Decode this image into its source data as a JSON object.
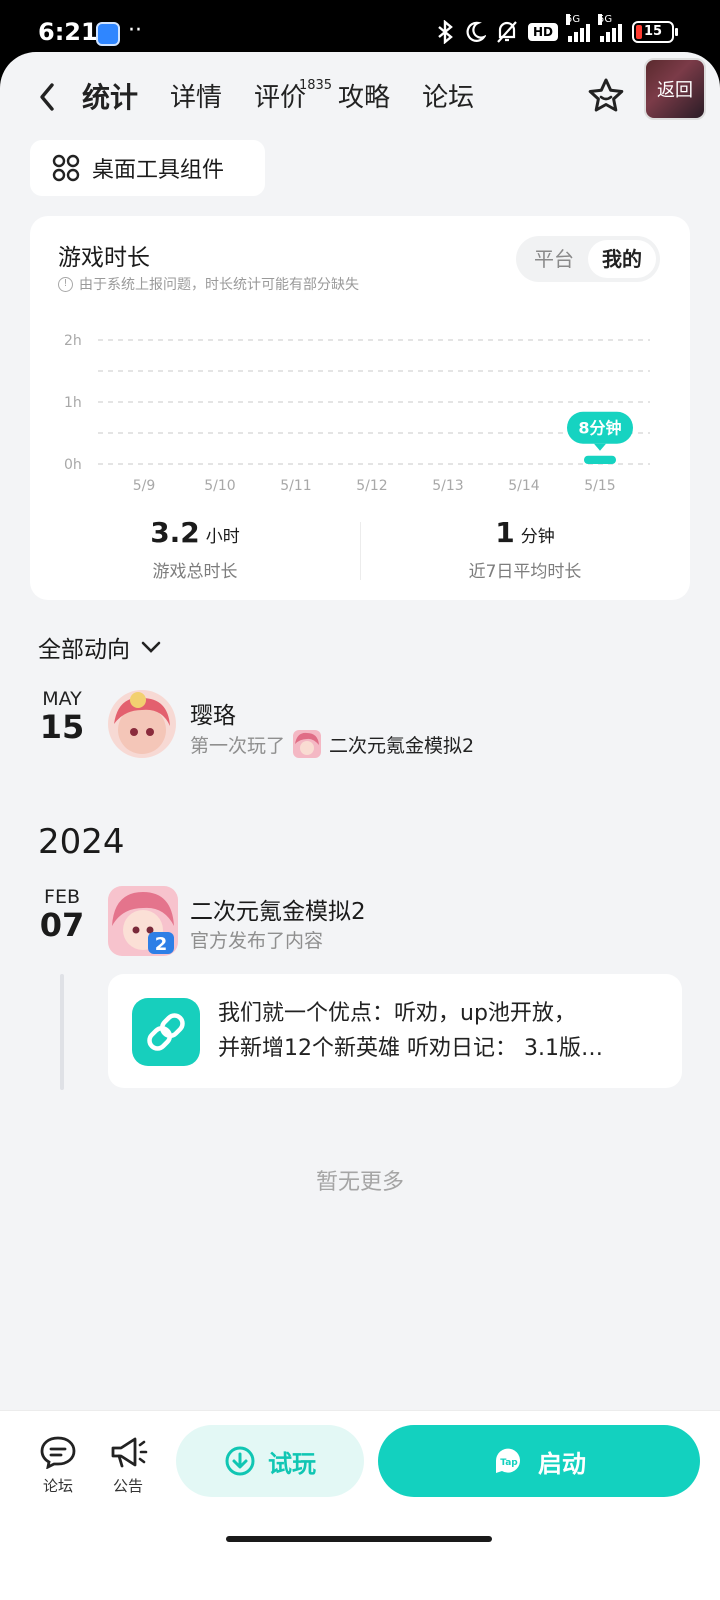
{
  "status_bar": {
    "time": "6:21",
    "dots": "··",
    "hd_badge": "HD",
    "network_1": "5G",
    "network_2": "5G",
    "battery_level": "15"
  },
  "nav": {
    "tabs": [
      {
        "label": "统计",
        "active": true
      },
      {
        "label": "详情",
        "active": false
      },
      {
        "label": "评价",
        "badge": "1835",
        "active": false
      },
      {
        "label": "攻略",
        "active": false
      },
      {
        "label": "论坛",
        "active": false
      }
    ],
    "return_label": "返回"
  },
  "widget_button": {
    "label": "桌面工具组件"
  },
  "stats_card": {
    "title": "游戏时长",
    "note": "由于系统上报问题，时长统计可能有部分缺失",
    "segments": [
      "平台",
      "我的"
    ],
    "selected_segment": "我的",
    "total": {
      "value": "3.2",
      "unit": "小时",
      "label": "游戏总时长"
    },
    "average": {
      "value": "1",
      "unit": "分钟",
      "label": "近7日平均时长"
    }
  },
  "chart_data": {
    "type": "bar",
    "categories": [
      "5/9",
      "5/10",
      "5/11",
      "5/12",
      "5/13",
      "5/14",
      "5/15"
    ],
    "values_minutes": [
      0,
      0,
      0,
      0,
      0,
      0,
      8
    ],
    "y_ticks": [
      "2h",
      "1h",
      "0h"
    ],
    "ylim_minutes": [
      0,
      120
    ],
    "grid": true,
    "highlight_label": "8分钟",
    "accent_color": "#16d3c1"
  },
  "feed": {
    "filter_label": "全部动向",
    "items": [
      {
        "month": "MAY",
        "day": "15",
        "name": "璎珞",
        "action": "第一次玩了",
        "game": "二次元氪金模拟2"
      }
    ],
    "year_heading": "2024",
    "items_2024": [
      {
        "month": "FEB",
        "day": "07",
        "name": "二次元氪金模拟2",
        "action": "官方发布了内容",
        "post_text_line1": "我们就一个优点：听劝，up池开放，",
        "post_text_line2": "并新增12个新英雄 听劝日记： 3.1版…"
      }
    ],
    "end_text": "暂无更多"
  },
  "bottom_bar": {
    "forum_label": "论坛",
    "notice_label": "公告",
    "trial_label": "试玩",
    "launch_label": "启动",
    "tap_logo_text": "Tap"
  },
  "colors": {
    "accent": "#16d3c1",
    "background": "#f3f4f6",
    "card": "#ffffff"
  }
}
